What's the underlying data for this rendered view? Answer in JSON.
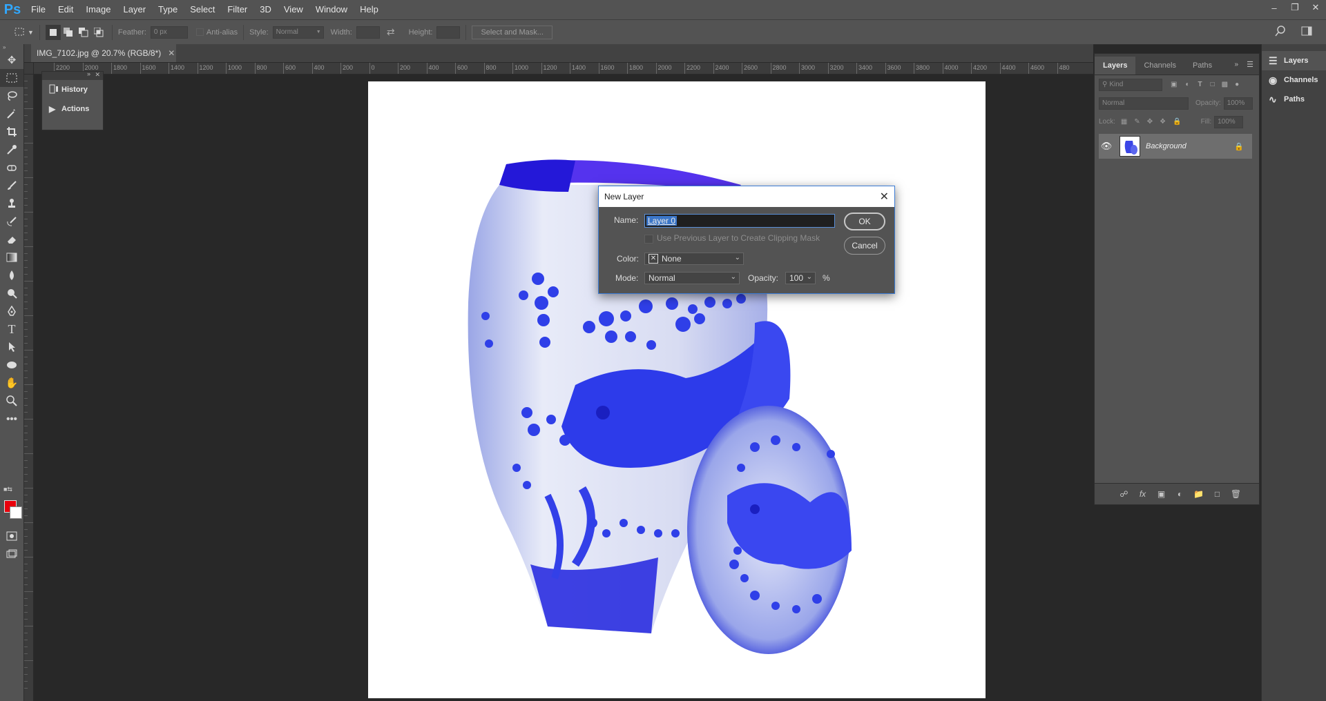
{
  "app": {
    "logo": "Ps"
  },
  "menu": [
    "File",
    "Edit",
    "Image",
    "Layer",
    "Type",
    "Select",
    "Filter",
    "3D",
    "View",
    "Window",
    "Help"
  ],
  "window_controls": [
    "minimize-icon",
    "restore-icon",
    "close-icon"
  ],
  "options_bar": {
    "feather_label": "Feather:",
    "feather_value": "0 px",
    "antialias_label": "Anti-alias",
    "style_label": "Style:",
    "style_value": "Normal",
    "width_label": "Width:",
    "height_label": "Height:",
    "select_mask_label": "Select and Mask..."
  },
  "document": {
    "tab_title": "IMG_7102.jpg @ 20.7% (RGB/8*)",
    "ruler_labels": [
      "2200",
      "2000",
      "1800",
      "1600",
      "1400",
      "1200",
      "1000",
      "800",
      "600",
      "400",
      "200",
      "0",
      "200",
      "400",
      "600",
      "800",
      "1000",
      "1200",
      "1400",
      "1600",
      "1800",
      "2000",
      "2200",
      "2400",
      "2600",
      "2800",
      "3000",
      "3200",
      "3400",
      "3600",
      "3800",
      "4000",
      "4200",
      "4400",
      "4600",
      "480"
    ]
  },
  "history_panel": {
    "items": [
      {
        "label": "History",
        "icon": "history-icon"
      },
      {
        "label": "Actions",
        "icon": "play-icon"
      }
    ]
  },
  "right_dock": {
    "items": [
      {
        "label": "Layers",
        "icon": "layers-icon"
      },
      {
        "label": "Channels",
        "icon": "channels-icon"
      },
      {
        "label": "Paths",
        "icon": "paths-icon"
      }
    ]
  },
  "layers_panel": {
    "tabs": [
      "Layers",
      "Channels",
      "Paths"
    ],
    "kind_label": "Kind",
    "blend_mode": "Normal",
    "opacity_label": "Opacity:",
    "opacity_value": "100%",
    "lock_label": "Lock:",
    "fill_label": "Fill:",
    "fill_value": "100%",
    "layers": [
      {
        "name": "Background",
        "visible": true,
        "locked": true
      }
    ]
  },
  "dialog": {
    "title": "New Layer",
    "name_label": "Name:",
    "name_value": "Layer 0",
    "clip_label": "Use Previous Layer to Create Clipping Mask",
    "color_label": "Color:",
    "color_value": "None",
    "mode_label": "Mode:",
    "mode_value": "Normal",
    "opacity_label": "Opacity:",
    "opacity_value": "100",
    "percent": "%",
    "ok_label": "OK",
    "cancel_label": "Cancel"
  },
  "colors": {
    "foreground": "#e8000b",
    "background": "#ffffff",
    "accent": "#31a8ff"
  }
}
